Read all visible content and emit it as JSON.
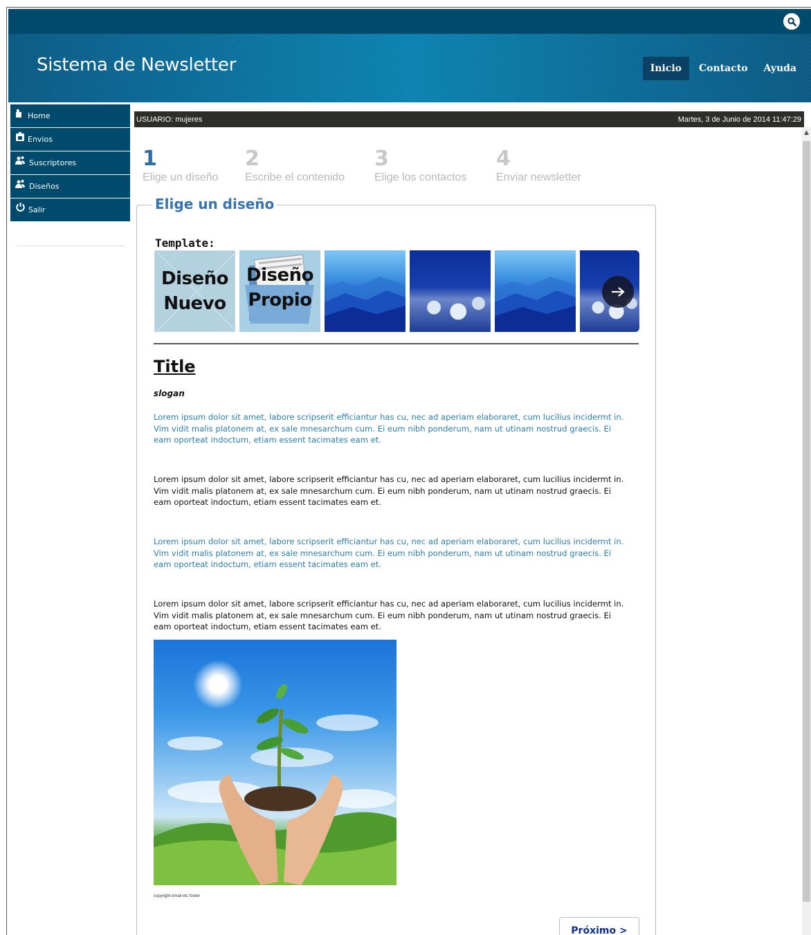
{
  "header": {
    "site_title": "Sistema de Newsletter",
    "nav": [
      "Inicio",
      "Contacto",
      "Ayuda"
    ],
    "active_nav": "Inicio"
  },
  "sidebar": {
    "items": [
      {
        "label": "Home",
        "icon": "home-icon"
      },
      {
        "label": "Envios",
        "icon": "envelope-icon"
      },
      {
        "label": "Suscriptores",
        "icon": "users-icon"
      },
      {
        "label": "Diseños",
        "icon": "users-icon"
      },
      {
        "label": "Salir",
        "icon": "power-icon"
      }
    ]
  },
  "userbar": {
    "user": "USUARIO: mujeres",
    "datetime": "Martes, 3 de Junio de 2014 11:47:29"
  },
  "steps": [
    {
      "num": "1",
      "label": "Elige un diseño",
      "active": true
    },
    {
      "num": "2",
      "label": "Escribe el contenido",
      "active": false
    },
    {
      "num": "3",
      "label": "Elige los contactos",
      "active": false
    },
    {
      "num": "4",
      "label": "Enviar newsletter",
      "active": false
    }
  ],
  "panel": {
    "legend": "Elige un diseño",
    "template_label": "Template:",
    "templates": [
      {
        "text_line1": "Diseño",
        "text_line2": "Nuevo"
      },
      {
        "text_line1": "Diseño",
        "text_line2": "Propio"
      }
    ]
  },
  "preview": {
    "title": "Title",
    "slogan": "slogan",
    "paragraphs": [
      "Lorem ipsum dolor sit amet, labore scripserit efficiantur has cu, nec ad aperiam elaboraret, cum lucilius incidermt in. Vim vidit malis platonem at, ex sale mnesarchum cum. Ei eum nibh ponderum, nam ut utinam nostrud graecis. Ei eam oporteat indoctum, etiam essent tacimates eam et.",
      "Lorem ipsum dolor sit amet, labore scripserit efficiantur has cu, nec ad aperiam elaboraret, cum lucilius incidermt in. Vim vidit malis platonem at, ex sale mnesarchum cum. Ei eum nibh ponderum, nam ut utinam nostrud graecis. Ei eam oporteat indoctum, etiam essent tacimates eam et.",
      "Lorem ipsum dolor sit amet, labore scripserit efficiantur has cu, nec ad aperiam elaboraret, cum lucilius incidermt in. Vim vidit malis platonem at, ex sale mnesarchum cum. Ei eum nibh ponderum, nam ut utinam nostrud graecis. Ei eam oporteat indoctum, etiam essent tacimates eam et.",
      "Lorem ipsum dolor sit amet, labore scripserit efficiantur has cu, nec ad aperiam elaboraret, cum lucilius incidermt in. Vim vidit malis platonem at, ex sale mnesarchum cum. Ei eum nibh ponderum, nam ut utinam nostrud graecis. Ei eam oporteat indoctum, etiam essent tacimates eam et."
    ],
    "copyright": "copyright email etc footer"
  },
  "next_button": "Próximo >",
  "colors": {
    "header_dark": "#004a6e",
    "accent_blue": "#3572b0",
    "link_blue": "#2a7fb0"
  }
}
